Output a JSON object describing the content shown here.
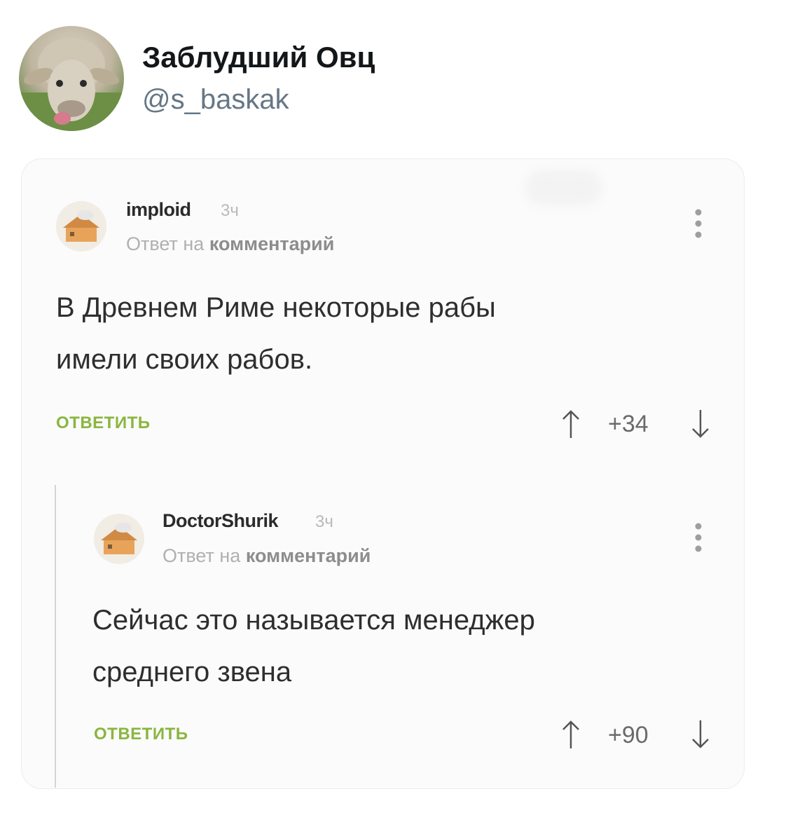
{
  "tweet": {
    "name": "Заблудший Овц",
    "handle": "@s_baskak"
  },
  "comments": [
    {
      "author": "imploid",
      "time": "3ч",
      "reply_prefix": "Ответ на",
      "reply_target": "комментарий",
      "text_lines": [
        "В Древнем Риме некоторые рабы",
        "имели своих рабов."
      ],
      "reply_button": "ОТВЕТИТЬ",
      "score": "+34"
    },
    {
      "author": "DoctorShurik",
      "time": "3ч",
      "reply_prefix": "Ответ на",
      "reply_target": "комментарий",
      "text_lines": [
        "Сейчас это называется менеджер",
        "среднего звена"
      ],
      "reply_button": "ОТВЕТИТЬ",
      "score": "+90"
    }
  ],
  "icons": {
    "avatar": "sheep-avatar",
    "comment_avatar": "cottage-avatar-icon",
    "upvote": "arrow-up-icon",
    "downvote": "arrow-down-icon",
    "more": "vertical-dots-icon"
  },
  "colors": {
    "name": "#14171a",
    "handle": "#657786",
    "reply_button": "#8ab63f",
    "thread_line": "#d4d4d4"
  }
}
